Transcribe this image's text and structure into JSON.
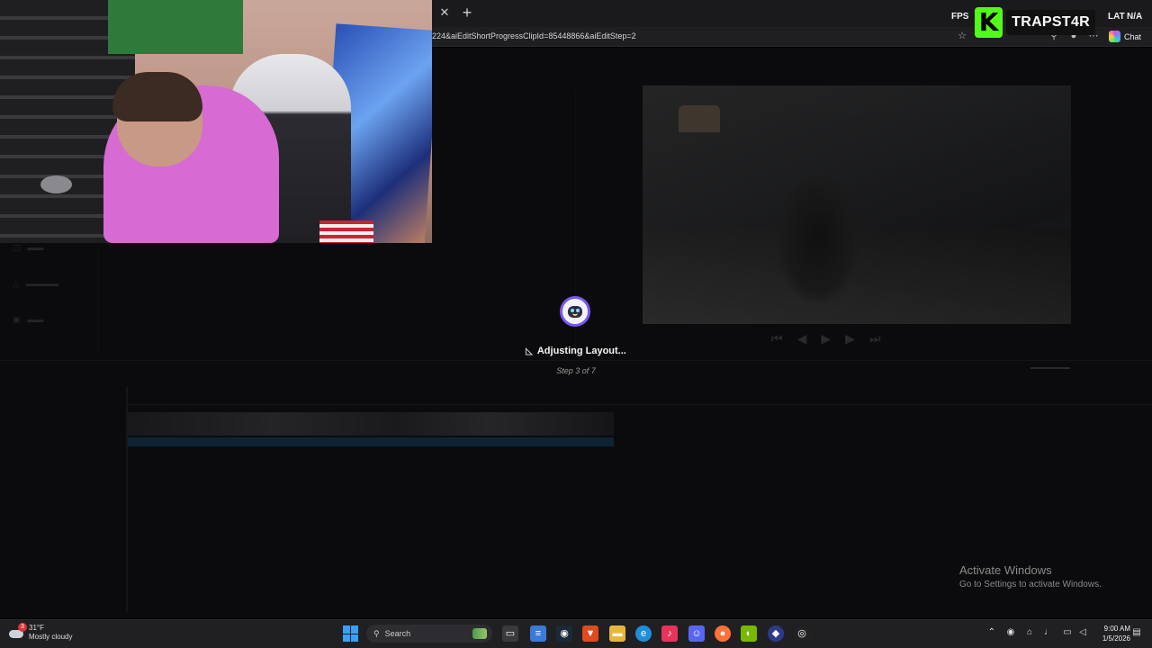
{
  "browser": {
    "url_fragment": "224&aiEditShortProgressClipId=85448866&aiEditStep=2",
    "chat_label": "Chat",
    "overlay_fps_label": "FPS",
    "overlay_lat_label": "LAT",
    "overlay_lat_value": "N/A"
  },
  "streamer": {
    "platform_logo": "K",
    "name": "TRAPST4R",
    "brand_color": "#53fc18"
  },
  "loader": {
    "title": "Adjusting Layout...",
    "step": "Step 3 of 7",
    "accent_color": "#7a56f0"
  },
  "watermark": {
    "heading": "Activate Windows",
    "subtext": "Go to Settings to activate Windows."
  },
  "taskbar": {
    "weather": {
      "temp": "31°F",
      "condition": "Mostly cloudy",
      "badge": "3"
    },
    "search_placeholder": "Search",
    "apps": [
      "windows-start",
      "search",
      "task-view",
      "notepad",
      "steam",
      "brave",
      "file-explorer",
      "edge",
      "tiktok",
      "discord",
      "firefox",
      "nvidia",
      "app",
      "obs"
    ],
    "clock": {
      "time": "9:00 AM",
      "date": "1/5/2026"
    }
  }
}
